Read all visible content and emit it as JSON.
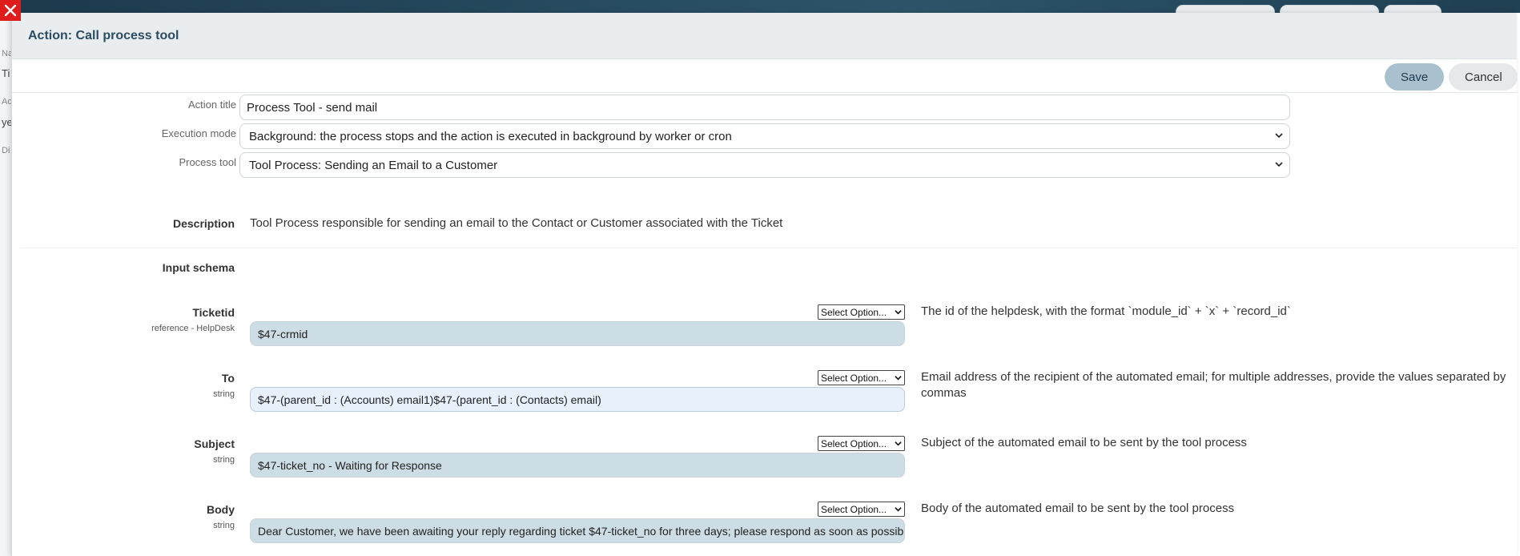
{
  "modal": {
    "title": "Action: Call process tool",
    "save_label": "Save",
    "cancel_label": "Cancel"
  },
  "form": {
    "action_title_label": "Action title",
    "action_title_value": "Process Tool - send mail",
    "execution_mode_label": "Execution mode",
    "execution_mode_value": "Background: the process stops and the action is executed in background by worker or cron",
    "process_tool_label": "Process tool",
    "process_tool_value": "Tool Process: Sending an Email to a Customer"
  },
  "description": {
    "label": "Description",
    "text": "Tool Process responsible for sending an email to the Contact or Customer associated with the Ticket"
  },
  "input_schema": {
    "label": "Input schema",
    "select_placeholder": "Select Option...",
    "params": [
      {
        "name": "Ticketid",
        "type": "reference - HelpDesk",
        "value": "$47-crmid",
        "help": "The id of the helpdesk, with the format `module_id` + `x` + `record_id`"
      },
      {
        "name": "To",
        "type": "string",
        "value": "$47-(parent_id : (Accounts) email1)$47-(parent_id : (Contacts) email)",
        "help": "Email address of the recipient of the automated email; for multiple addresses, provide the values separated by commas"
      },
      {
        "name": "Subject",
        "type": "string",
        "value": "$47-ticket_no - Waiting for Response",
        "help": "Subject of the automated email to be sent by the tool process"
      },
      {
        "name": "Body",
        "type": "string",
        "value": "Dear Customer, we have been awaiting your reply regarding ticket $47-ticket_no for three days; please respond as soon as possible.",
        "help": "Body of the automated email to be sent by the tool process"
      }
    ]
  },
  "background": {
    "left_letters": [
      "Na",
      "Ti",
      "Ac",
      "ye",
      "Di"
    ]
  },
  "colors": {
    "header_bg": "#e9edf0",
    "title_color": "#2b4c61",
    "save_bg": "#a9c1cf",
    "input_tint": "#cddde5",
    "close_red": "#e01b1b"
  }
}
